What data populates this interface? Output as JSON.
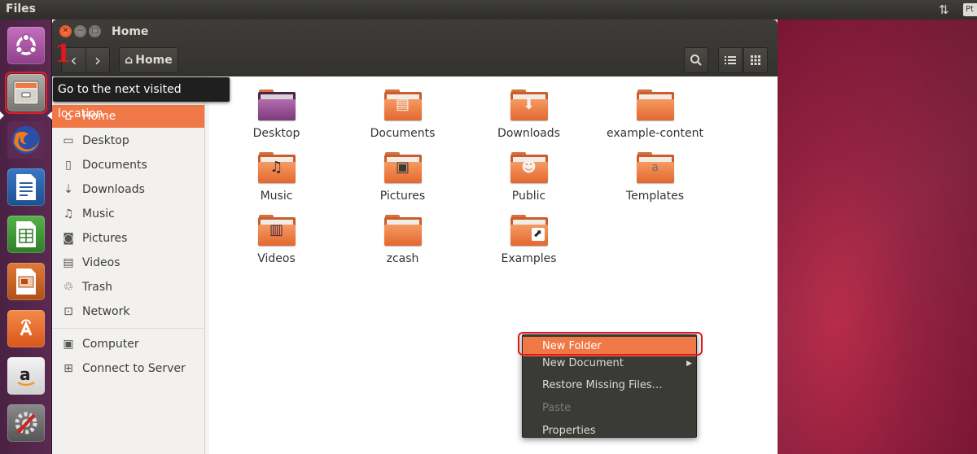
{
  "top_panel": {
    "title": "Files",
    "net_icon": "⇅",
    "keyboard_indicator": "Pt"
  },
  "launcher": {
    "items": [
      {
        "name": "ubuntu-dash",
        "icon": "ubuntu-logo-icon"
      },
      {
        "name": "files",
        "icon": "file-cabinet-icon"
      },
      {
        "name": "firefox",
        "icon": "firefox-icon"
      },
      {
        "name": "writer",
        "icon": "libreoffice-writer-icon"
      },
      {
        "name": "calc",
        "icon": "libreoffice-calc-icon"
      },
      {
        "name": "impress",
        "icon": "libreoffice-impress-icon"
      },
      {
        "name": "software-center",
        "icon": "shopping-bag-icon"
      },
      {
        "name": "amazon",
        "icon": "amazon-icon"
      },
      {
        "name": "system-settings",
        "icon": "settings-wrench-icon"
      }
    ]
  },
  "annotation": {
    "step": "1"
  },
  "window": {
    "title": "Home",
    "toolbar": {
      "back": "‹",
      "forward": "›",
      "path_home_label": "Home"
    }
  },
  "tooltip": {
    "text": "Go to the next visited location"
  },
  "sidebar": {
    "items": [
      {
        "label": "Home",
        "icon": "⌂"
      },
      {
        "label": "Desktop",
        "icon": "▭"
      },
      {
        "label": "Documents",
        "icon": "▯"
      },
      {
        "label": "Downloads",
        "icon": "⇣"
      },
      {
        "label": "Music",
        "icon": "♫"
      },
      {
        "label": "Pictures",
        "icon": "◙"
      },
      {
        "label": "Videos",
        "icon": "▤"
      },
      {
        "label": "Trash",
        "icon": "♲"
      },
      {
        "label": "Network",
        "icon": "⊡"
      },
      {
        "label": "Computer",
        "icon": "▣"
      },
      {
        "label": "Connect to Server",
        "icon": "⊞"
      }
    ]
  },
  "files": [
    {
      "label": "Desktop",
      "emblem": ""
    },
    {
      "label": "Documents",
      "emblem": "▤"
    },
    {
      "label": "Downloads",
      "emblem": "⬇"
    },
    {
      "label": "example-content",
      "emblem": ""
    },
    {
      "label": "Music",
      "emblem": "♫"
    },
    {
      "label": "Pictures",
      "emblem": "▣"
    },
    {
      "label": "Public",
      "emblem": "☻"
    },
    {
      "label": "Templates",
      "emblem": "a"
    },
    {
      "label": "Videos",
      "emblem": "▥"
    },
    {
      "label": "zcash",
      "emblem": ""
    },
    {
      "label": "Examples",
      "emblem": "⬈"
    }
  ],
  "context_menu": {
    "items": [
      {
        "label": "New Folder"
      },
      {
        "label": "New Document"
      },
      {
        "label": "Restore Missing Files…"
      },
      {
        "label": "Paste"
      },
      {
        "label": "Properties"
      }
    ]
  },
  "colors": {
    "accent": "#f07846",
    "annotation_red": "#e0191e",
    "launcher_bg": "#5b2a52",
    "panel_bg": "#3c3b37"
  }
}
